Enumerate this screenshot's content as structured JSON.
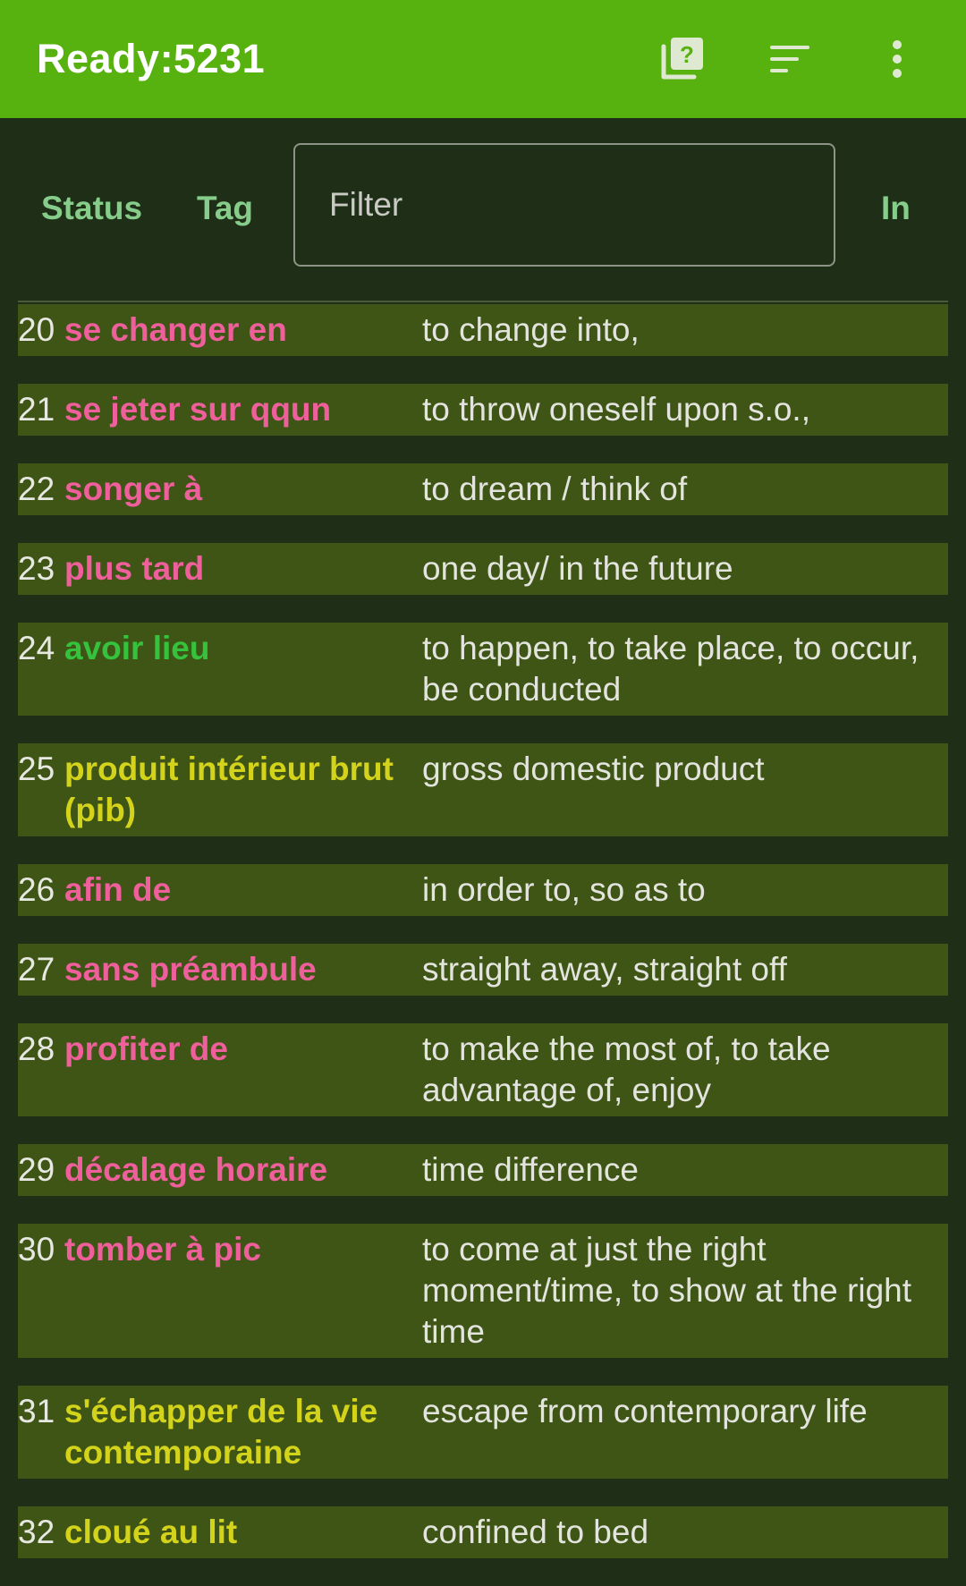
{
  "appbar": {
    "title": "Ready:5231",
    "icons": [
      "help-cards-icon",
      "sort-icon",
      "more-vert-icon"
    ],
    "help_glyph": "?"
  },
  "filters": {
    "status_label": "Status",
    "tag_label": "Tag",
    "filter_placeholder": "Filter",
    "filter_value": "",
    "in_label": "In"
  },
  "colors": {
    "appbar": "#57b10f",
    "background": "#1f2e16",
    "row": "#3e5516",
    "term_pink": "#ef5f9b",
    "term_green": "#35c23c",
    "term_yellow": "#d4d31c",
    "button_text": "#86cc8a"
  },
  "cards": [
    {
      "num": "20",
      "term": "se changer en",
      "definition": "to change into,",
      "color": "pink"
    },
    {
      "num": "21",
      "term": "se jeter sur qqun",
      "definition": "to throw oneself upon s.o.,",
      "color": "pink"
    },
    {
      "num": "22",
      "term": "songer à",
      "definition": "to dream / think of",
      "color": "pink"
    },
    {
      "num": "23",
      "term": "plus tard",
      "definition": "one day/ in the future",
      "color": "pink"
    },
    {
      "num": "24",
      "term": "avoir lieu",
      "definition": "to happen, to take place, to occur, be conducted",
      "color": "green"
    },
    {
      "num": "25",
      "term": "produit intérieur brut (pib)",
      "definition": "gross domestic product",
      "color": "yellow"
    },
    {
      "num": "26",
      "term": "afin de",
      "definition": "in order to, so as to",
      "color": "pink"
    },
    {
      "num": "27",
      "term": "sans préambule",
      "definition": "straight away, straight off",
      "color": "pink"
    },
    {
      "num": "28",
      "term": "profiter de",
      "definition": "to make the most of, to take advantage of, enjoy",
      "color": "pink"
    },
    {
      "num": "29",
      "term": "décalage horaire",
      "definition": "time difference",
      "color": "pink"
    },
    {
      "num": "30",
      "term": "tomber à pic",
      "definition": "to come at just the right moment/time, to show at the right time",
      "color": "pink"
    },
    {
      "num": "31",
      "term": "s'échapper de la vie contemporaine",
      "definition": "escape from contemporary life",
      "color": "yellow"
    },
    {
      "num": "32",
      "term": "cloué au lit",
      "definition": "confined to bed",
      "color": "yellow"
    }
  ]
}
